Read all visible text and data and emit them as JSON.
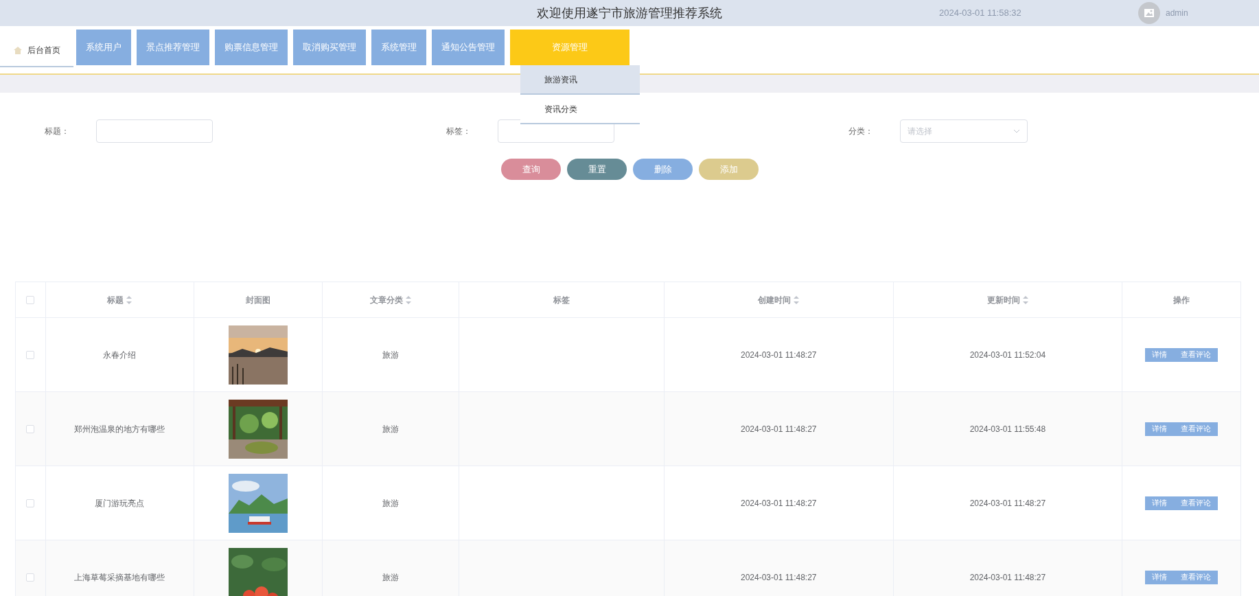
{
  "header": {
    "title": "欢迎使用遂宁市旅游管理推荐系统",
    "datetime": "2024-03-01 11:58:32",
    "user": "admin"
  },
  "home_tab": {
    "label": "后台首页",
    "selected": true
  },
  "nav": [
    {
      "label": "系统用户",
      "selected": false
    },
    {
      "label": "景点推荐管理",
      "selected": false
    },
    {
      "label": "购票信息管理",
      "selected": false
    },
    {
      "label": "取消购买管理",
      "selected": false
    },
    {
      "label": "系统管理",
      "selected": false
    },
    {
      "label": "通知公告管理",
      "selected": false
    },
    {
      "label": "资源管理",
      "selected": true
    }
  ],
  "dropdown": [
    {
      "label": "旅游资讯",
      "selected": true
    },
    {
      "label": "资讯分类",
      "selected": false
    }
  ],
  "filters": [
    {
      "label": "标题：",
      "kind": "input"
    },
    {
      "label": "标签：",
      "kind": "input"
    },
    {
      "label": "分类：",
      "kind": "select",
      "placeholder": "请选择"
    }
  ],
  "actions": [
    {
      "label": "查询",
      "color": "#d98d9a"
    },
    {
      "label": "重置",
      "color": "#668c96"
    },
    {
      "label": "删除",
      "color": "#86aee0"
    },
    {
      "label": "添加",
      "color": "#dccb8e"
    }
  ],
  "table": {
    "select_all": {
      "checked": false
    },
    "columns": [
      {
        "label": "标题",
        "sortable": true
      },
      {
        "label": "封面图",
        "sortable": false
      },
      {
        "label": "文章分类",
        "sortable": true
      },
      {
        "label": "标签",
        "sortable": false
      },
      {
        "label": "创建时间",
        "sortable": true
      },
      {
        "label": "更新时间",
        "sortable": true
      },
      {
        "label": "操作",
        "sortable": false
      }
    ],
    "rows": [
      {
        "checked": false,
        "title": "永春介绍",
        "cover": {
          "kind": "picture"
        },
        "category": "旅游",
        "created": "2024-03-01 11:48:27",
        "updated": "2024-03-01 11:52:04",
        "buttons": [
          "详情",
          "查看评论"
        ]
      },
      {
        "checked": false,
        "title": "郑州泡温泉的地方有哪些",
        "cover": {
          "kind": "picture"
        },
        "category": "旅游",
        "created": "2024-03-01 11:48:27",
        "updated": "2024-03-01 11:55:48",
        "buttons": [
          "详情",
          "查看评论"
        ]
      },
      {
        "checked": false,
        "title": "厦门游玩亮点",
        "cover": {
          "kind": "picture"
        },
        "category": "旅游",
        "created": "2024-03-01 11:48:27",
        "updated": "2024-03-01 11:48:27",
        "buttons": [
          "详情",
          "查看评论"
        ]
      },
      {
        "checked": false,
        "title": "上海草莓采摘基地有哪些",
        "cover": {
          "kind": "picture"
        },
        "category": "旅游",
        "created": "2024-03-01 11:48:27",
        "updated": "2024-03-01 11:48:27",
        "buttons": [
          "详情",
          "查看评论"
        ]
      }
    ]
  }
}
